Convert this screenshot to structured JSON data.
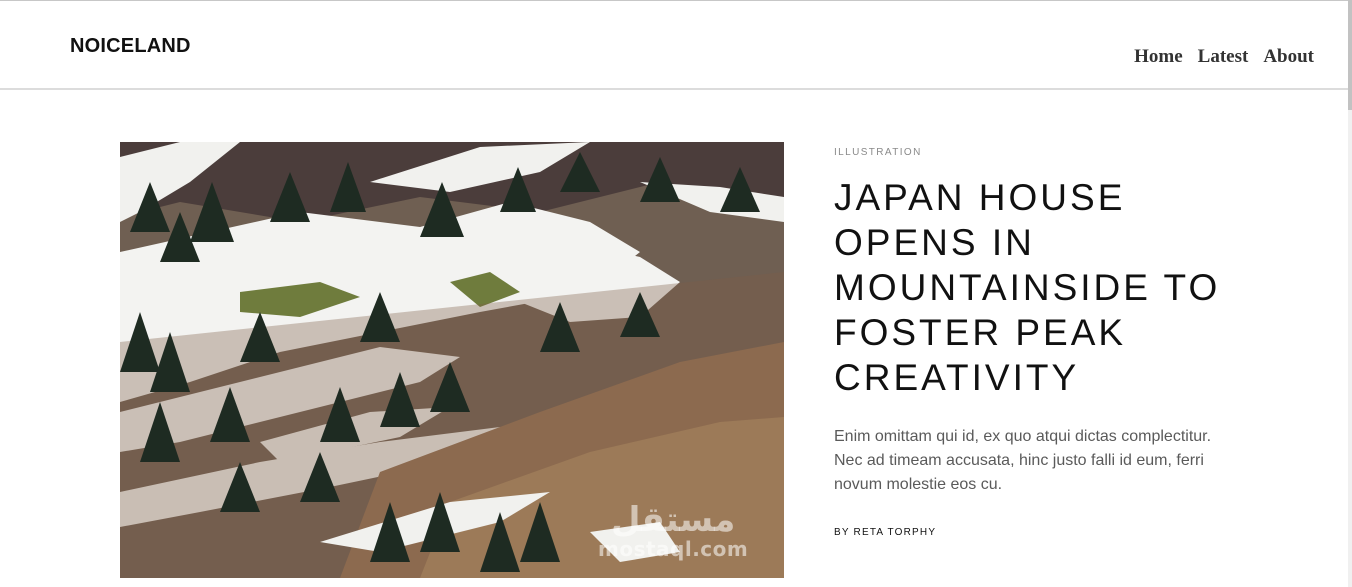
{
  "header": {
    "logo": "NOICELAND",
    "nav": [
      "Home",
      "Latest",
      "About"
    ]
  },
  "article": {
    "category": "ILLUSTRATION",
    "title": "JAPAN HOUSE OPENS IN MOUNTAINSIDE TO FOSTER PEAK CREATIVITY",
    "excerpt": "Enim omittam qui id, ex quo atqui dictas complectitur. Nec ad timeam accusata, hinc justo falli id eum, ferri novum molestie eos cu.",
    "byline": "BY RETA TORPHY"
  },
  "watermark": {
    "arabic": "مستقل",
    "latin": "mostaql.com"
  },
  "colors": {
    "snow": "#f4f4f2",
    "rock_dark": "#4e4444",
    "rock_brown": "#8c6a4f",
    "trees": "#1f2d22",
    "grass": "#6c7a3c"
  }
}
